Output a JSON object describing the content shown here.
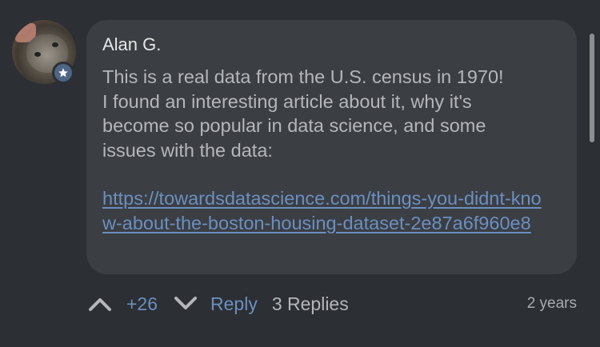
{
  "comment": {
    "author": "Alan G.",
    "body": "This is a real data from the U.S. census in 1970!\nI found an interesting article about it, why it's\nbecome so popular in data science, and some\nissues with the data:",
    "link": "https://towardsdatascience.com/things-you-didnt-know-about-the-boston-housing-dataset-2e87a6f960e8",
    "avatar_badge_icon": "star-icon"
  },
  "actions": {
    "upvote_icon": "chevron-up-icon",
    "score": "+26",
    "downvote_icon": "chevron-down-icon",
    "reply_label": "Reply",
    "replies_label": "3 Replies",
    "timestamp": "2 years"
  },
  "colors": {
    "background": "#2c2f33",
    "bubble": "#3b3e43",
    "link": "#6b8fc0",
    "text": "#b4b6ba",
    "badge": "#4e6685"
  }
}
